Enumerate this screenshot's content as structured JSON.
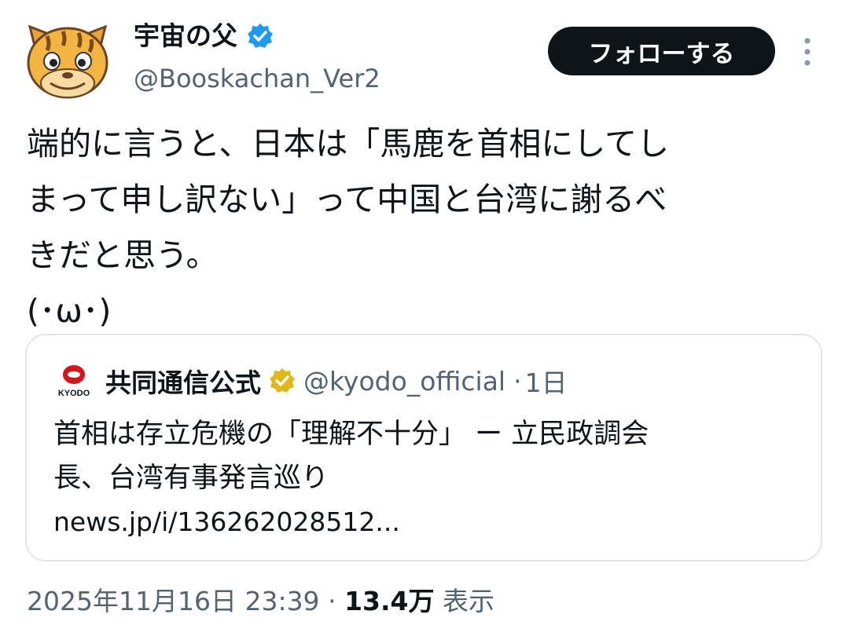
{
  "author": {
    "display_name": "宇宙の父",
    "handle": "@Booskachan_Ver2"
  },
  "follow_button": {
    "label": "フォローする"
  },
  "more_button": {
    "icon": "more-vertical-icon"
  },
  "tweet": {
    "text": "端的に言うと、日本は「馬鹿を首相にしてし\nまって申し訳ない」って中国と台湾に謝るべ\nきだと思う。\n(･ω･)"
  },
  "quote": {
    "logo_text": "KYODO",
    "name": "共同通信公式",
    "handle": "@kyodo_official",
    "separator": "·",
    "time": "1日",
    "body": "首相は存立危機の「理解不十分」 ー 立民政調会\n長、台湾有事発言巡り",
    "link": "news.jp/i/136262028512..."
  },
  "meta": {
    "timestamp": "2025年11月16日 23:39",
    "separator": "·",
    "views_count": "13.4万",
    "views_label": "表示"
  },
  "colors": {
    "text": "#0f1419",
    "secondary": "#536471",
    "verified_blue": "#1d9bf0",
    "verified_gold": "#e2b719",
    "kyodo_red": "#d7141a",
    "border": "#e1e5e9"
  }
}
